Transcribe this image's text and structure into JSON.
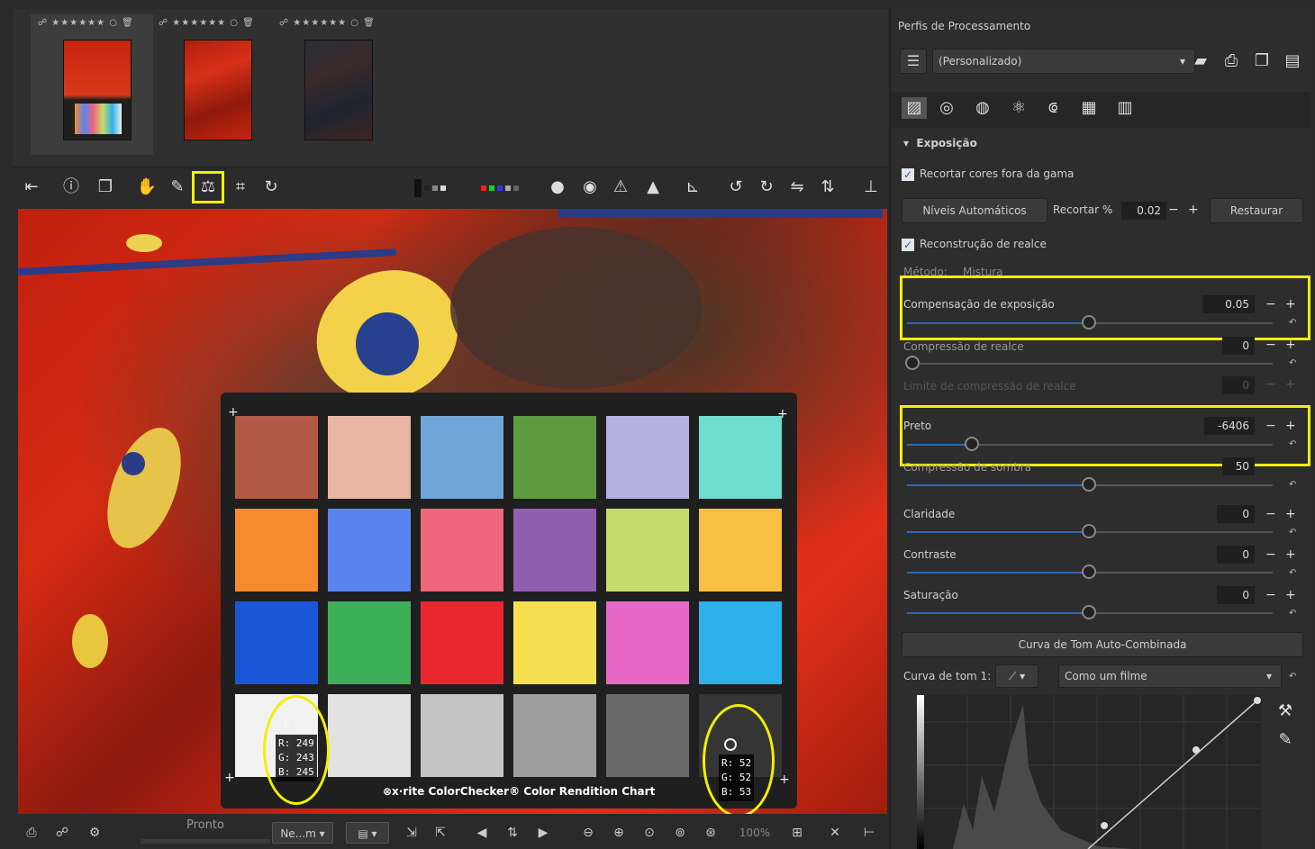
{
  "filmstrip": {
    "thumbs": [
      {
        "meta": "☍ ★★★★★★ ○ 🗑",
        "selected": true
      },
      {
        "meta": "☍ ★★★★★★ ○ 🗑",
        "selected": false
      },
      {
        "meta": "☍ ★★★★★★ ○ 🗑",
        "selected": false
      }
    ]
  },
  "toolbar": {
    "icons": [
      "sidebar-toggle-icon",
      "info-icon",
      "before-after-icon",
      "hand-icon",
      "color-picker-icon",
      "white-balance-picker-icon",
      "crop-icon",
      "rotate-icon"
    ],
    "right_icons": [
      "focus-mask-icon",
      "shadow-clipping-icon",
      "warning-icon",
      "highlight-warning-icon",
      "perspective-icon",
      "rotate-left-icon",
      "rotate-right-icon",
      "flip-horizontal-icon",
      "flip-vertical-icon",
      "right-panel-toggle-icon"
    ],
    "accent": "#f0f000"
  },
  "colorchecker": {
    "label": "⊗x·rite ColorChecker® Color Rendition Chart",
    "patches": [
      "#b15a45",
      "#eab5a5",
      "#6ea6d8",
      "#5e9a40",
      "#b6b1e0",
      "#6fdcd0",
      "#f58b2c",
      "#5a84f0",
      "#f0667a",
      "#9060b0",
      "#c4dd6a",
      "#f8c042",
      "#1a56d8",
      "#3fb05a",
      "#e8282e",
      "#f6e050",
      "#e868c8",
      "#2eb0e8",
      "#f2f2f2",
      "#e2e2e2",
      "#c4c4c4",
      "#9e9e9e",
      "#686868",
      "#353535"
    ],
    "readout_left": {
      "r": "R: 249",
      "g": "G: 243",
      "b": "B: 245"
    },
    "readout_right": {
      "r": "R: 52",
      "g": "G: 52",
      "b": "B: 53"
    }
  },
  "statusbar": {
    "status": "Pronto",
    "combo": "Ne...m",
    "zoom": "100%"
  },
  "panel": {
    "profiles_title": "Perfis de Processamento",
    "profile_value": "(Personalizado)",
    "section": "Exposição",
    "clip_oog": "Recortar cores fora da gama",
    "auto_levels": "Níveis Automáticos",
    "clip_label": "Recortar %",
    "clip_value": "0.02",
    "reset": "Restaurar",
    "hl_reconstruction": "Reconstrução de realce",
    "method_label": "Método:",
    "method_value": "Mistura",
    "exp_comp": {
      "label": "Compensação de exposição",
      "value": "0.05"
    },
    "hl_comp": {
      "label": "Compressão de realce",
      "value": "0"
    },
    "hl_comp_thr": {
      "label": "Limite de compressão de realce",
      "value": "0"
    },
    "black": {
      "label": "Preto",
      "value": "-6406"
    },
    "shadow_comp": {
      "label": "Compressão de sombra",
      "value": "50"
    },
    "lightness": {
      "label": "Claridade",
      "value": "0"
    },
    "contrast": {
      "label": "Contraste",
      "value": "0"
    },
    "saturation": {
      "label": "Saturação",
      "value": "0"
    },
    "auto_tone_curve": "Curva de Tom Auto-Combinada",
    "tone_curve_label": "Curva de tom 1:",
    "tone_curve_mode": "Como um filme"
  }
}
